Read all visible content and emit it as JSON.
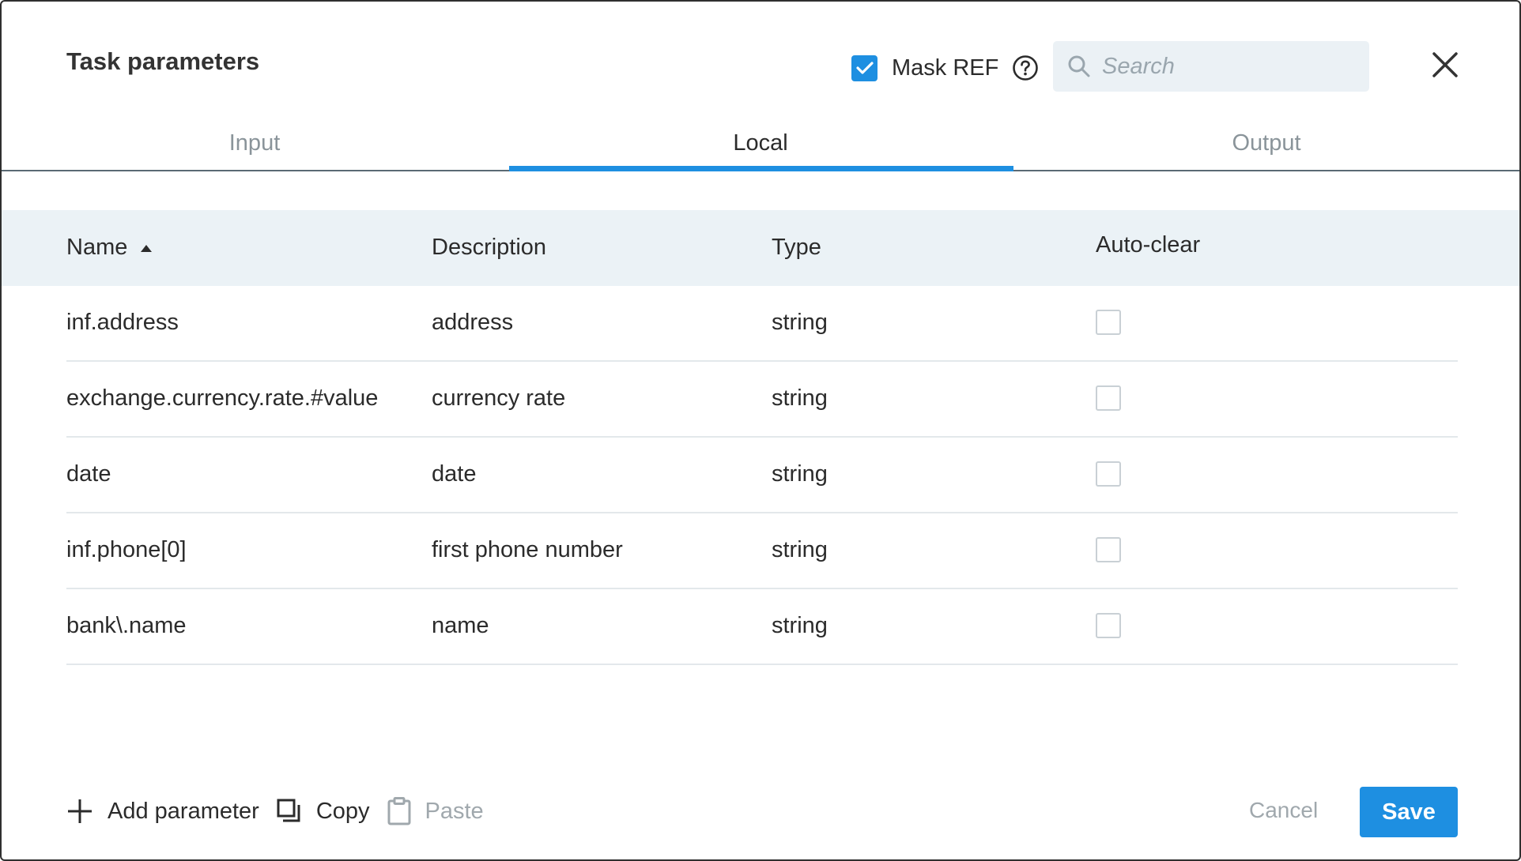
{
  "dialog": {
    "title": "Task parameters",
    "mask_ref": {
      "label": "Mask REF",
      "checked": true
    },
    "search": {
      "placeholder": "Search",
      "value": ""
    },
    "close_icon": "close-icon",
    "help_icon": "help-circle-icon"
  },
  "tabs": [
    {
      "label": "Input",
      "active": false
    },
    {
      "label": "Local",
      "active": true
    },
    {
      "label": "Output",
      "active": false
    }
  ],
  "table": {
    "headers": {
      "name": "Name",
      "description": "Description",
      "type": "Type",
      "auto_clear": "Auto-clear"
    },
    "sort": {
      "column": "name",
      "direction": "ascending",
      "icon": "sort-ascending-icon"
    },
    "rows": [
      {
        "name": "inf.address",
        "description": "address",
        "type": "string",
        "auto_clear": false
      },
      {
        "name": "exchange.currency.rate.#value",
        "description": "currency rate",
        "type": "string",
        "auto_clear": false
      },
      {
        "name": "date",
        "description": "date",
        "type": "string",
        "auto_clear": false
      },
      {
        "name": "inf.phone[0]",
        "description": "first phone number",
        "type": "string",
        "auto_clear": false
      },
      {
        "name": "bank\\.name",
        "description": "name",
        "type": "string",
        "auto_clear": false
      }
    ]
  },
  "footer": {
    "add_label": "Add parameter",
    "copy_label": "Copy",
    "paste_label": "Paste",
    "paste_disabled": true,
    "cancel_label": "Cancel",
    "save_label": "Save"
  },
  "colors": {
    "accent": "#1e8fe1",
    "header_bg": "#ebf2f6",
    "search_bg": "#ebf1f5",
    "muted_text": "#a0a8ad"
  }
}
